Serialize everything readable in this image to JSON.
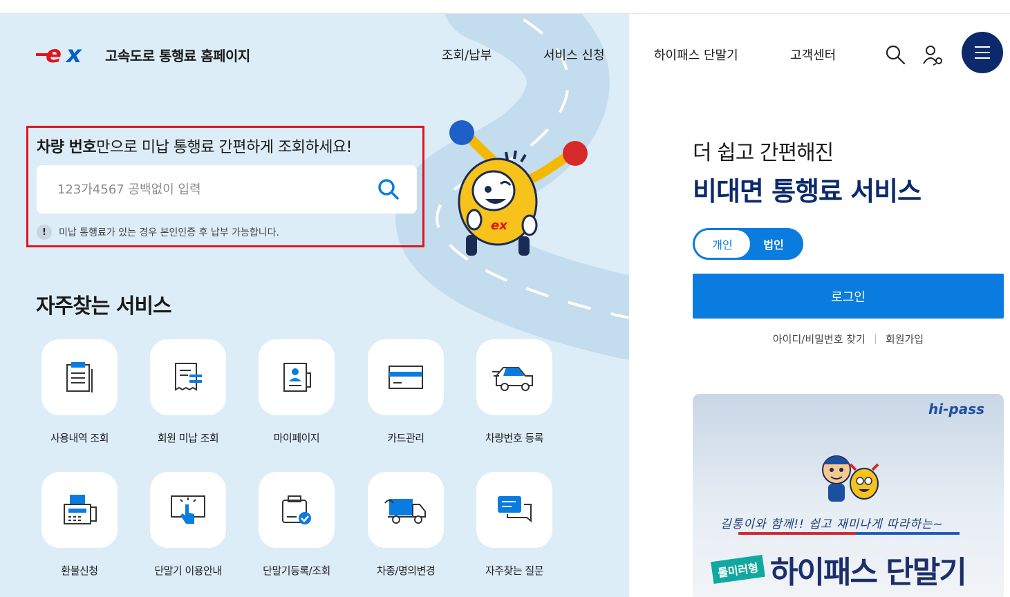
{
  "header": {
    "site_title": "고속도로 통행료 홈페이지",
    "nav": [
      "조회/납부",
      "서비스 신청",
      "하이패스 단말기",
      "고객센터"
    ]
  },
  "search": {
    "heading_bold": "차량 번호",
    "heading_rest": "만으로 미납 통행료 간편하게 조회하세요!",
    "placeholder": "123가4567 공백없이 입력",
    "notice": "미납 통행료가 있는 경우 본인인증 후 납부 가능합니다.",
    "notice_icon": "!"
  },
  "services": {
    "title": "자주찾는 서비스",
    "items": [
      {
        "label": "사용내역 조회",
        "icon": "document-list-icon"
      },
      {
        "label": "회원 미납 조회",
        "icon": "receipt-icon"
      },
      {
        "label": "마이페이지",
        "icon": "profile-card-icon"
      },
      {
        "label": "카드관리",
        "icon": "card-icon"
      },
      {
        "label": "차량번호 등록",
        "icon": "car-icon"
      },
      {
        "label": "환불신청",
        "icon": "fax-icon"
      },
      {
        "label": "단말기 이용안내",
        "icon": "touch-screen-icon"
      },
      {
        "label": "단말기등록/조회",
        "icon": "device-check-icon"
      },
      {
        "label": "차종/명의변경",
        "icon": "truck-icon"
      },
      {
        "label": "자주찾는 질문",
        "icon": "chat-icon"
      }
    ]
  },
  "panel": {
    "promo_line1": "더 쉽고 간편해진",
    "promo_line2": "비대면 통행료 서비스",
    "toggle": [
      "개인",
      "법인"
    ],
    "login": "로그인",
    "find": "아이디/비밀번호 찾기",
    "join": "회원가입"
  },
  "banner": {
    "brand": "hi-pass",
    "tagline": "길통이와 함께!! 쉽고 재미나게 따라하는~",
    "badge": "롤미러형",
    "title": "하이패스 단말기"
  },
  "colors": {
    "accent": "#0a7ce0",
    "navy": "#0c2a6b",
    "left_bg": "#dcedf8",
    "highlight": "#e0141e"
  }
}
